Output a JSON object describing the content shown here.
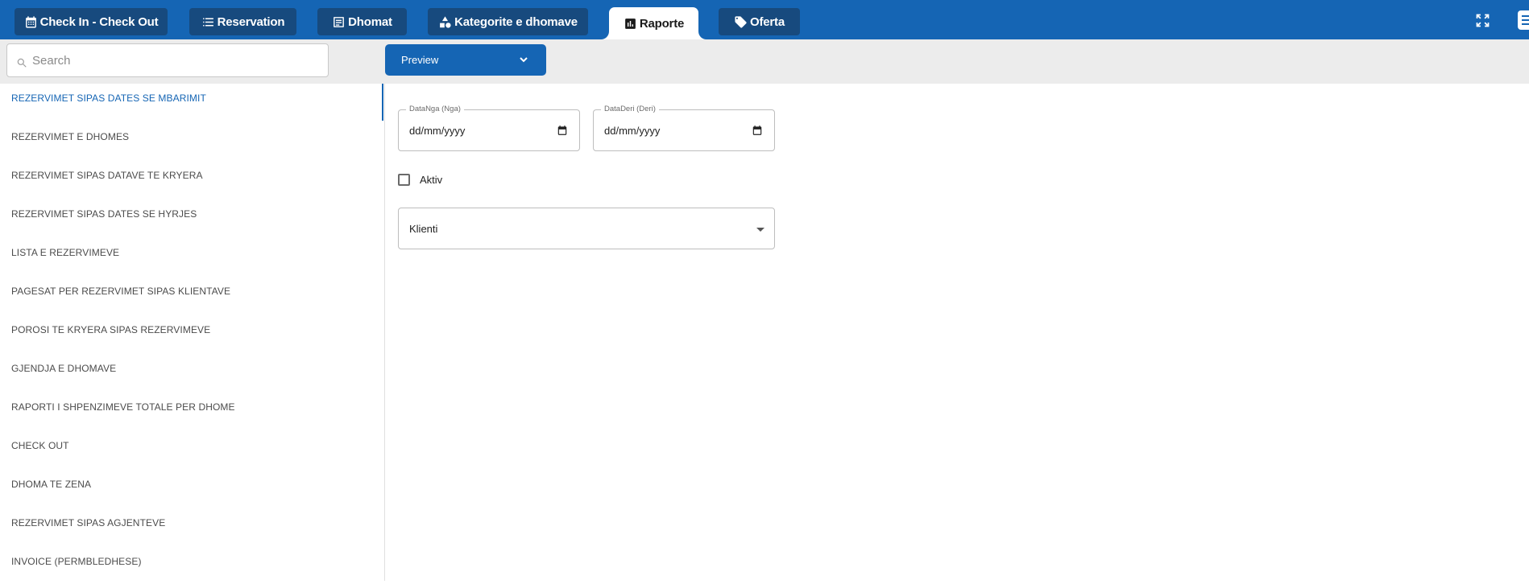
{
  "topbar": {
    "tabs": [
      {
        "label": "Check In - Check Out",
        "icon": "calendar-icon"
      },
      {
        "label": "Reservation",
        "icon": "list-icon"
      },
      {
        "label": "Dhomat",
        "icon": "bed-icon"
      },
      {
        "label": "Kategorite e dhomave",
        "icon": "shapes-icon"
      },
      {
        "label": "Raporte",
        "icon": "bar-chart-icon",
        "active": true
      },
      {
        "label": "Oferta",
        "icon": "tag-icon"
      }
    ],
    "right_icons": [
      "fullscreen-icon",
      "menu-icon"
    ]
  },
  "toolbar": {
    "search_placeholder": "Search",
    "preview_label": "Preview"
  },
  "sidebar": {
    "active_index": 0,
    "items": [
      "REZERVIMET SIPAS DATES SE MBARIMIT",
      "REZERVIMET E DHOMES",
      "REZERVIMET SIPAS DATAVE TE KRYERA",
      "REZERVIMET SIPAS DATES SE HYRJES",
      "LISTA E REZERVIMEVE",
      "PAGESAT PER REZERVIMET SIPAS KLIENTAVE",
      "POROSI TE KRYERA SIPAS REZERVIMEVE",
      "GJENDJA E DHOMAVE",
      "RAPORTI I SHPENZIMEVE TOTALE PER DHOME",
      "CHECK OUT",
      "DHOMA TE ZENA",
      "REZERVIMET SIPAS AGJENTEVE",
      "INVOICE (PERMBLEDHESE)"
    ]
  },
  "form": {
    "date_from": {
      "label": "DataNga (Nga)",
      "placeholder": "dd/mm/yyyy"
    },
    "date_to": {
      "label": "DataDeri (Deri)",
      "placeholder": "dd/mm/yyyy"
    },
    "checkbox_label": "Aktiv",
    "checkbox_checked": false,
    "client_select": {
      "label": "Klienti"
    }
  },
  "colors": {
    "primary": "#1565b4",
    "tab_dark": "#174a7e",
    "toolbar_bg": "#ececec"
  }
}
